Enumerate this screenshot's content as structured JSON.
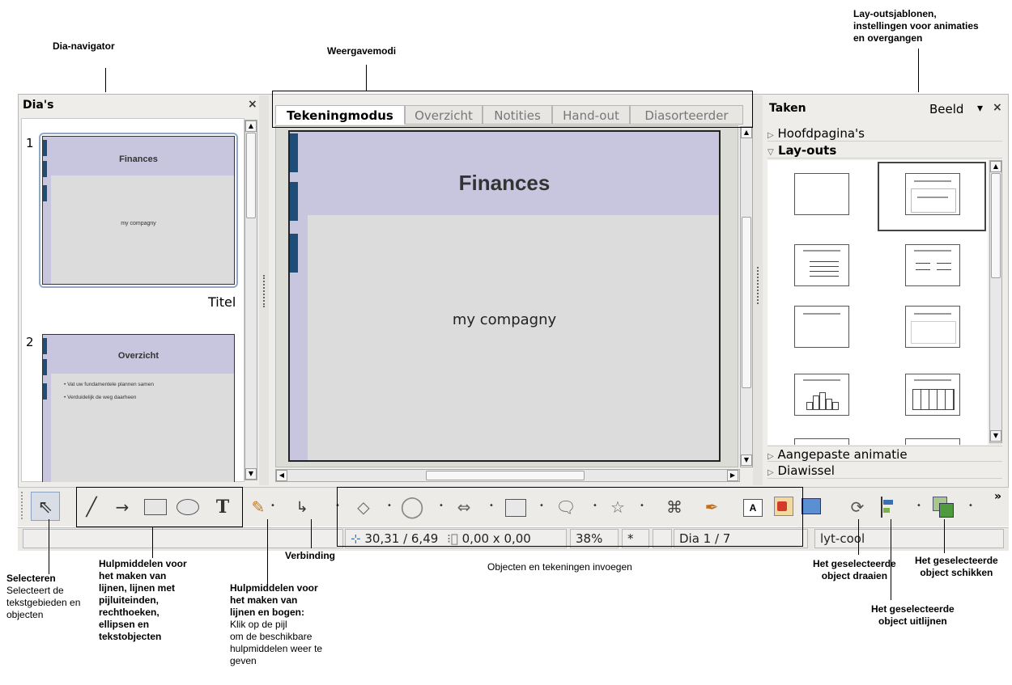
{
  "callouts": {
    "dia_navigator": "Dia-navigator",
    "weergavemodi": "Weergavemodi",
    "layouts": [
      "Lay-outsjablonen,",
      "instellingen voor animaties",
      "en overgangen"
    ],
    "selecteren_title": "Selecteren",
    "selecteren_desc": [
      "Selecteert de",
      "tekstgebieden en",
      "objecten"
    ],
    "hulp_lijnen": [
      "Hulpmiddelen voor",
      "het maken van",
      "lijnen, lijnen met",
      "pijluiteinden,",
      "rechthoeken,",
      "ellipsen en",
      "tekstobjecten"
    ],
    "verbinding": "Verbinding",
    "hulp_bogen_title": [
      "Hulpmiddelen voor",
      "het maken van",
      "lijnen en bogen:"
    ],
    "hulp_bogen_desc": [
      "Klik op de pijl",
      "om de beschikbare",
      "hulpmiddelen weer te",
      "geven"
    ],
    "objecten_invoegen": "Objecten en tekeningen invoegen",
    "draaien": [
      "Het geselecteerde",
      "object draaien"
    ],
    "schikken": [
      "Het geselecteerde",
      "object schikken"
    ],
    "uitlijnen": [
      "Het geselecteerde",
      "object uitlijnen"
    ]
  },
  "slides_panel": {
    "title": "Dia's",
    "close": "×",
    "slides": [
      {
        "number": "1",
        "title": "Finances",
        "body": "my compagny",
        "label": "Titel"
      },
      {
        "number": "2",
        "title": "Overzicht",
        "bullets": [
          "Vat uw fundamentele plannen samen",
          "Verduidelijk de weg daarheen"
        ]
      }
    ]
  },
  "tabs": [
    "Tekeningmodus",
    "Overzicht",
    "Notities",
    "Hand-out",
    "Diasorteerder"
  ],
  "active_tab": "Tekeningmodus",
  "main_slide": {
    "title": "Finances",
    "body": "my compagny"
  },
  "tasks_panel": {
    "title": "Taken",
    "view_label": "Beeld",
    "dropdown": "▾",
    "close": "×",
    "sections": {
      "master": "Hoofdpagina's",
      "layouts": "Lay-outs",
      "animation": "Aangepaste animatie",
      "transition": "Diawissel"
    }
  },
  "toolbar": {
    "icons": [
      "select-icon",
      "line-icon",
      "arrow-line-icon",
      "rectangle-icon",
      "ellipse-icon",
      "text-icon",
      "curve-icon",
      "connector-icon",
      "basic-shapes-icon",
      "symbol-shapes-icon",
      "block-arrows-icon",
      "flowchart-icon",
      "callouts-icon",
      "stars-icon",
      "points-icon",
      "glue-points-icon",
      "fontwork-icon",
      "from-file-icon",
      "slide-show-icon",
      "rotate-icon",
      "align-icon",
      "arrange-icon"
    ],
    "overflow": "»"
  },
  "status_bar": {
    "position": "30,31 / 6,49",
    "size": "0,00 x 0,00",
    "zoom": "38%",
    "modified": "*",
    "slide": "Dia 1 / 7",
    "master": "lyt-cool"
  },
  "colors": {
    "slide_header": "#c8c6df",
    "slide_body": "#dcdcdc",
    "accent_tab": "#1e4d78"
  }
}
